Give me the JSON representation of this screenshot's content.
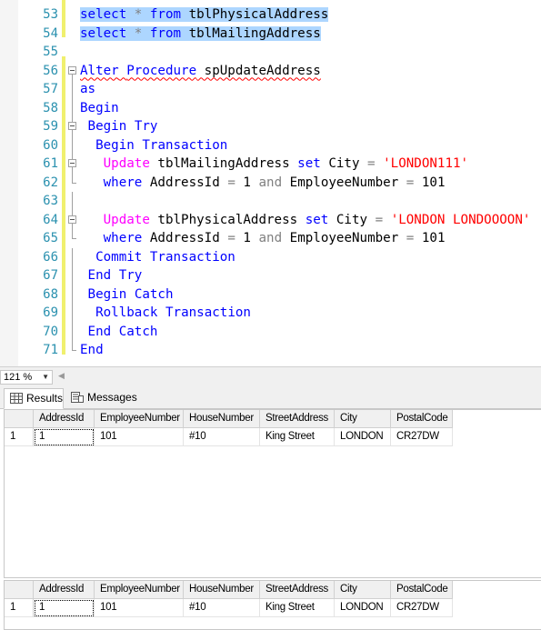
{
  "editor": {
    "lines": [
      {
        "n": "53",
        "tokens": [
          {
            "t": "select",
            "c": "kw",
            "s": 1
          },
          {
            "t": " ",
            "s": 1
          },
          {
            "t": "*",
            "c": "gray",
            "s": 1
          },
          {
            "t": " ",
            "s": 1
          },
          {
            "t": "from",
            "c": "kw",
            "s": 1
          },
          {
            "t": " tblPhysicalAddress",
            "s": 1
          }
        ]
      },
      {
        "n": "54",
        "tokens": [
          {
            "t": "select",
            "c": "kw",
            "s": 1
          },
          {
            "t": " ",
            "s": 1
          },
          {
            "t": "*",
            "c": "gray",
            "s": 1
          },
          {
            "t": " ",
            "s": 1
          },
          {
            "t": "from",
            "c": "kw",
            "s": 1
          },
          {
            "t": " tblMailingAddress",
            "s": 1
          }
        ]
      },
      {
        "n": "55",
        "tokens": []
      },
      {
        "n": "56",
        "tokens": [
          {
            "t": "Alter",
            "c": "kw",
            "w": 1
          },
          {
            "t": " ",
            "w": 1
          },
          {
            "t": "Procedure",
            "c": "kw",
            "w": 1
          },
          {
            "t": " spUpdateAddress",
            "w": 1
          }
        ]
      },
      {
        "n": "57",
        "tokens": [
          {
            "t": "as",
            "c": "kw"
          }
        ]
      },
      {
        "n": "58",
        "tokens": [
          {
            "t": "Begin",
            "c": "kw"
          }
        ]
      },
      {
        "n": "59",
        "tokens": [
          {
            "t": " "
          },
          {
            "t": "Begin",
            "c": "kw"
          },
          {
            "t": " "
          },
          {
            "t": "Try",
            "c": "kw"
          }
        ]
      },
      {
        "n": "60",
        "tokens": [
          {
            "t": "  "
          },
          {
            "t": "Begin",
            "c": "kw"
          },
          {
            "t": " "
          },
          {
            "t": "Transaction",
            "c": "kw"
          }
        ]
      },
      {
        "n": "61",
        "tokens": [
          {
            "t": "   "
          },
          {
            "t": "Update",
            "c": "fn"
          },
          {
            "t": " tblMailingAddress "
          },
          {
            "t": "set",
            "c": "kw"
          },
          {
            "t": " City "
          },
          {
            "t": "=",
            "c": "gray"
          },
          {
            "t": " "
          },
          {
            "t": "'LONDON111'",
            "c": "str"
          }
        ]
      },
      {
        "n": "62",
        "tokens": [
          {
            "t": "   "
          },
          {
            "t": "where",
            "c": "kw"
          },
          {
            "t": " AddressId "
          },
          {
            "t": "=",
            "c": "gray"
          },
          {
            "t": " 1 "
          },
          {
            "t": "and",
            "c": "gray"
          },
          {
            "t": " EmployeeNumber "
          },
          {
            "t": "=",
            "c": "gray"
          },
          {
            "t": " 101"
          }
        ]
      },
      {
        "n": "63",
        "tokens": []
      },
      {
        "n": "64",
        "tokens": [
          {
            "t": "   "
          },
          {
            "t": "Update",
            "c": "fn"
          },
          {
            "t": " tblPhysicalAddress "
          },
          {
            "t": "set",
            "c": "kw"
          },
          {
            "t": " City "
          },
          {
            "t": "=",
            "c": "gray"
          },
          {
            "t": " "
          },
          {
            "t": "'LONDON LONDOOOON'",
            "c": "str"
          }
        ]
      },
      {
        "n": "65",
        "tokens": [
          {
            "t": "   "
          },
          {
            "t": "where",
            "c": "kw"
          },
          {
            "t": " AddressId "
          },
          {
            "t": "=",
            "c": "gray"
          },
          {
            "t": " 1 "
          },
          {
            "t": "and",
            "c": "gray"
          },
          {
            "t": " EmployeeNumber "
          },
          {
            "t": "=",
            "c": "gray"
          },
          {
            "t": " 101"
          }
        ]
      },
      {
        "n": "66",
        "tokens": [
          {
            "t": "  "
          },
          {
            "t": "Commit",
            "c": "kw"
          },
          {
            "t": " "
          },
          {
            "t": "Transaction",
            "c": "kw"
          }
        ]
      },
      {
        "n": "67",
        "tokens": [
          {
            "t": " "
          },
          {
            "t": "End",
            "c": "kw"
          },
          {
            "t": " "
          },
          {
            "t": "Try",
            "c": "kw"
          }
        ]
      },
      {
        "n": "68",
        "tokens": [
          {
            "t": " "
          },
          {
            "t": "Begin",
            "c": "kw"
          },
          {
            "t": " "
          },
          {
            "t": "Catch",
            "c": "kw"
          }
        ]
      },
      {
        "n": "69",
        "tokens": [
          {
            "t": "  "
          },
          {
            "t": "Rollback",
            "c": "kw"
          },
          {
            "t": " "
          },
          {
            "t": "Transaction",
            "c": "kw"
          }
        ]
      },
      {
        "n": "70",
        "tokens": [
          {
            "t": " "
          },
          {
            "t": "End",
            "c": "kw"
          },
          {
            "t": " "
          },
          {
            "t": "Catch",
            "c": "kw"
          }
        ]
      },
      {
        "n": "71",
        "tokens": [
          {
            "t": "End",
            "c": "kw"
          }
        ]
      }
    ]
  },
  "zoom": {
    "value": "121 %",
    "dropdown_icon": "chevron-down-icon"
  },
  "tabs": [
    {
      "label": "Results",
      "icon": "grid-icon",
      "active": true
    },
    {
      "label": "Messages",
      "icon": "messages-icon",
      "active": false
    }
  ],
  "results": [
    {
      "columns": [
        "AddressId",
        "EmployeeNumber",
        "HouseNumber",
        "StreetAddress",
        "City",
        "PostalCode"
      ],
      "rows": [
        [
          "1",
          "1",
          "101",
          "#10",
          "King Street",
          "LONDON",
          "CR27DW"
        ]
      ]
    },
    {
      "columns": [
        "AddressId",
        "EmployeeNumber",
        "HouseNumber",
        "StreetAddress",
        "City",
        "PostalCode"
      ],
      "rows": [
        [
          "1",
          "1",
          "101",
          "#10",
          "King Street",
          "LONDON",
          "CR27DW"
        ]
      ]
    }
  ],
  "colors": {
    "keyword": "#0000ff",
    "function": "#ff00ff",
    "string": "#ff0000",
    "operator": "#808080",
    "line_number": "#2b91af",
    "selection": "#add6ff",
    "change_bar": "#f0f06e"
  }
}
